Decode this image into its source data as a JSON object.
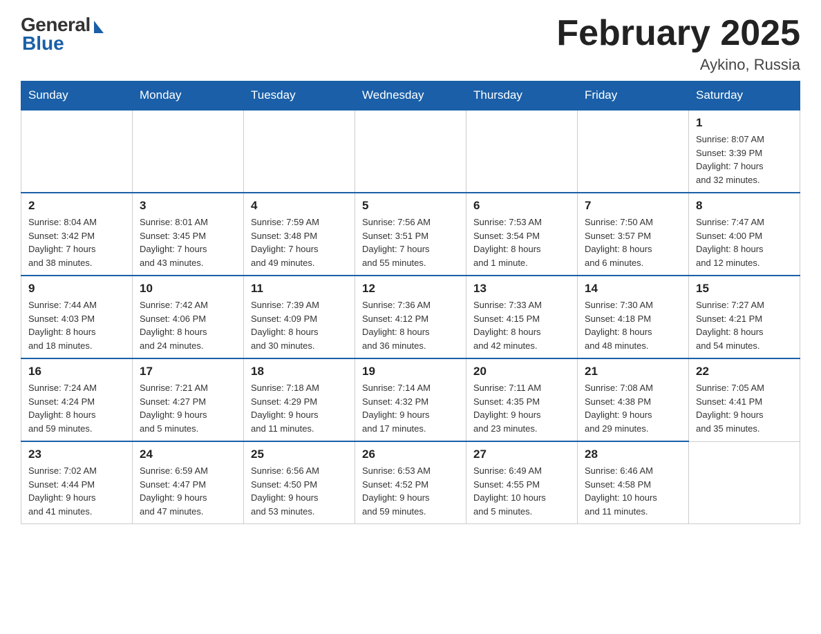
{
  "header": {
    "logo": {
      "general": "General",
      "blue": "Blue"
    },
    "title": "February 2025",
    "location": "Aykino, Russia"
  },
  "weekdays": [
    "Sunday",
    "Monday",
    "Tuesday",
    "Wednesday",
    "Thursday",
    "Friday",
    "Saturday"
  ],
  "weeks": [
    [
      {
        "day": "",
        "info": ""
      },
      {
        "day": "",
        "info": ""
      },
      {
        "day": "",
        "info": ""
      },
      {
        "day": "",
        "info": ""
      },
      {
        "day": "",
        "info": ""
      },
      {
        "day": "",
        "info": ""
      },
      {
        "day": "1",
        "info": "Sunrise: 8:07 AM\nSunset: 3:39 PM\nDaylight: 7 hours\nand 32 minutes."
      }
    ],
    [
      {
        "day": "2",
        "info": "Sunrise: 8:04 AM\nSunset: 3:42 PM\nDaylight: 7 hours\nand 38 minutes."
      },
      {
        "day": "3",
        "info": "Sunrise: 8:01 AM\nSunset: 3:45 PM\nDaylight: 7 hours\nand 43 minutes."
      },
      {
        "day": "4",
        "info": "Sunrise: 7:59 AM\nSunset: 3:48 PM\nDaylight: 7 hours\nand 49 minutes."
      },
      {
        "day": "5",
        "info": "Sunrise: 7:56 AM\nSunset: 3:51 PM\nDaylight: 7 hours\nand 55 minutes."
      },
      {
        "day": "6",
        "info": "Sunrise: 7:53 AM\nSunset: 3:54 PM\nDaylight: 8 hours\nand 1 minute."
      },
      {
        "day": "7",
        "info": "Sunrise: 7:50 AM\nSunset: 3:57 PM\nDaylight: 8 hours\nand 6 minutes."
      },
      {
        "day": "8",
        "info": "Sunrise: 7:47 AM\nSunset: 4:00 PM\nDaylight: 8 hours\nand 12 minutes."
      }
    ],
    [
      {
        "day": "9",
        "info": "Sunrise: 7:44 AM\nSunset: 4:03 PM\nDaylight: 8 hours\nand 18 minutes."
      },
      {
        "day": "10",
        "info": "Sunrise: 7:42 AM\nSunset: 4:06 PM\nDaylight: 8 hours\nand 24 minutes."
      },
      {
        "day": "11",
        "info": "Sunrise: 7:39 AM\nSunset: 4:09 PM\nDaylight: 8 hours\nand 30 minutes."
      },
      {
        "day": "12",
        "info": "Sunrise: 7:36 AM\nSunset: 4:12 PM\nDaylight: 8 hours\nand 36 minutes."
      },
      {
        "day": "13",
        "info": "Sunrise: 7:33 AM\nSunset: 4:15 PM\nDaylight: 8 hours\nand 42 minutes."
      },
      {
        "day": "14",
        "info": "Sunrise: 7:30 AM\nSunset: 4:18 PM\nDaylight: 8 hours\nand 48 minutes."
      },
      {
        "day": "15",
        "info": "Sunrise: 7:27 AM\nSunset: 4:21 PM\nDaylight: 8 hours\nand 54 minutes."
      }
    ],
    [
      {
        "day": "16",
        "info": "Sunrise: 7:24 AM\nSunset: 4:24 PM\nDaylight: 8 hours\nand 59 minutes."
      },
      {
        "day": "17",
        "info": "Sunrise: 7:21 AM\nSunset: 4:27 PM\nDaylight: 9 hours\nand 5 minutes."
      },
      {
        "day": "18",
        "info": "Sunrise: 7:18 AM\nSunset: 4:29 PM\nDaylight: 9 hours\nand 11 minutes."
      },
      {
        "day": "19",
        "info": "Sunrise: 7:14 AM\nSunset: 4:32 PM\nDaylight: 9 hours\nand 17 minutes."
      },
      {
        "day": "20",
        "info": "Sunrise: 7:11 AM\nSunset: 4:35 PM\nDaylight: 9 hours\nand 23 minutes."
      },
      {
        "day": "21",
        "info": "Sunrise: 7:08 AM\nSunset: 4:38 PM\nDaylight: 9 hours\nand 29 minutes."
      },
      {
        "day": "22",
        "info": "Sunrise: 7:05 AM\nSunset: 4:41 PM\nDaylight: 9 hours\nand 35 minutes."
      }
    ],
    [
      {
        "day": "23",
        "info": "Sunrise: 7:02 AM\nSunset: 4:44 PM\nDaylight: 9 hours\nand 41 minutes."
      },
      {
        "day": "24",
        "info": "Sunrise: 6:59 AM\nSunset: 4:47 PM\nDaylight: 9 hours\nand 47 minutes."
      },
      {
        "day": "25",
        "info": "Sunrise: 6:56 AM\nSunset: 4:50 PM\nDaylight: 9 hours\nand 53 minutes."
      },
      {
        "day": "26",
        "info": "Sunrise: 6:53 AM\nSunset: 4:52 PM\nDaylight: 9 hours\nand 59 minutes."
      },
      {
        "day": "27",
        "info": "Sunrise: 6:49 AM\nSunset: 4:55 PM\nDaylight: 10 hours\nand 5 minutes."
      },
      {
        "day": "28",
        "info": "Sunrise: 6:46 AM\nSunset: 4:58 PM\nDaylight: 10 hours\nand 11 minutes."
      },
      {
        "day": "",
        "info": ""
      }
    ]
  ]
}
